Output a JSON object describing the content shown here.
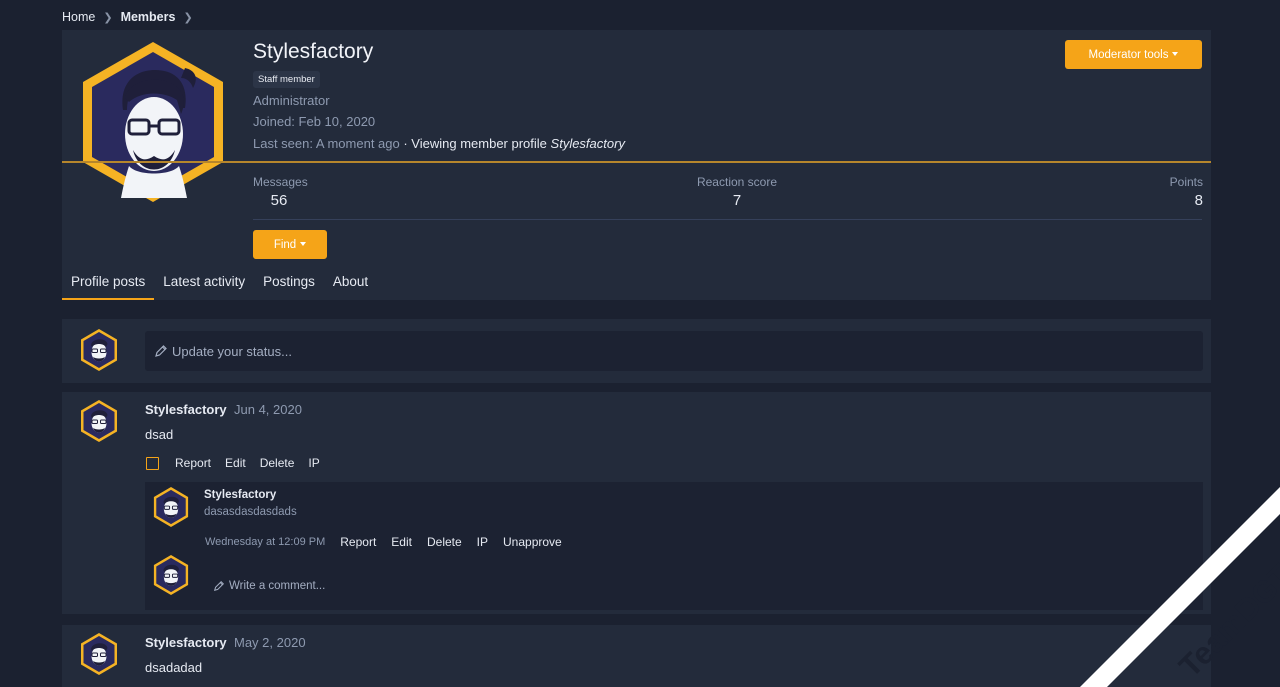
{
  "breadcrumb": {
    "home": "Home",
    "members": "Members"
  },
  "profile": {
    "name": "Stylesfactory",
    "badge": "Staff member",
    "role": "Administrator",
    "joined": "Joined: Feb 10, 2020",
    "last_seen_label": "Last seen:",
    "last_seen_value": "A moment ago",
    "activity": "· Viewing member profile",
    "activity_target": "Stylesfactory",
    "moderator_tools": "Moderator tools",
    "find": "Find"
  },
  "stats": {
    "messages_label": "Messages",
    "messages_value": "56",
    "reaction_label": "Reaction score",
    "reaction_value": "7",
    "points_label": "Points",
    "points_value": "8"
  },
  "tabs": [
    {
      "label": "Profile posts",
      "active": true
    },
    {
      "label": "Latest activity"
    },
    {
      "label": "Postings"
    },
    {
      "label": "About"
    }
  ],
  "status_placeholder": "Update your status...",
  "posts": [
    {
      "author": "Stylesfactory",
      "date": "Jun 4, 2020",
      "body": "dsad",
      "actions": [
        "Report",
        "Edit",
        "Delete",
        "IP"
      ],
      "comment": {
        "author": "Stylesfactory",
        "body": "dasasdasdasdads",
        "time": "Wednesday at 12:09 PM",
        "actions": [
          "Report",
          "Edit",
          "Delete",
          "IP",
          "Unapprove"
        ]
      },
      "write_comment": "Write a comment..."
    },
    {
      "author": "Stylesfactory",
      "date": "May 2, 2020",
      "body": "dsadadad"
    }
  ],
  "watermark": "TeamDGT.org",
  "colors": {
    "accent": "#f5a418",
    "background": "#1b2130",
    "panel": "#232b3b"
  },
  "icons": {
    "pencil": "pencil-icon",
    "caret": "caret-down-icon",
    "chevron": "chevron-right-icon"
  }
}
